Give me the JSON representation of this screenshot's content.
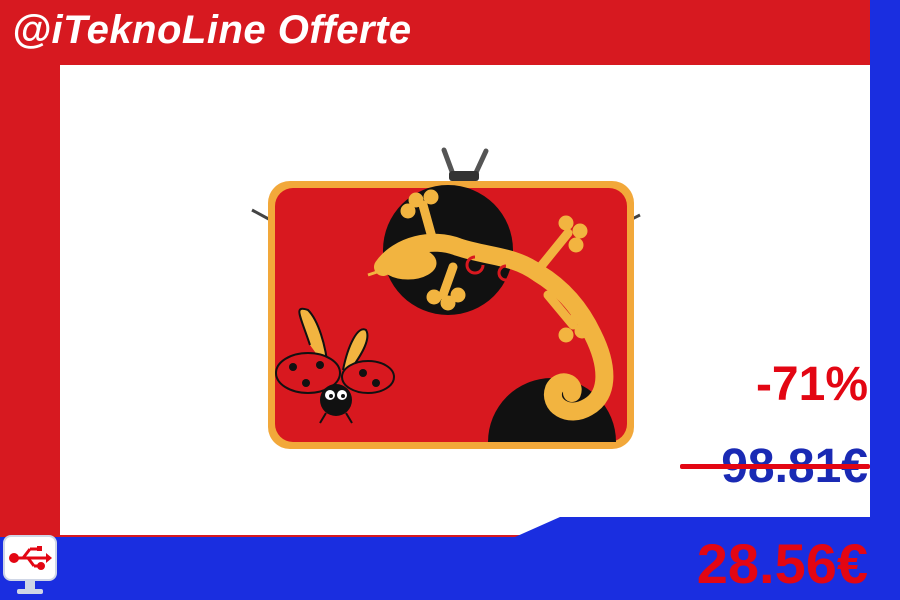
{
  "brand": {
    "title": "@iTeknoLine Offerte"
  },
  "product": {
    "image_name": "laptop-sleeve-red-gecko-ladybug",
    "colors": {
      "sleeve_red": "#d8181f",
      "sleeve_trim": "#f2a83a",
      "gecko_yellow": "#f2b440",
      "black": "#111111"
    }
  },
  "pricing": {
    "discount": "-71%",
    "old_price": "98.81€",
    "new_price": "28.56€"
  },
  "colors": {
    "brand_red": "#d71920",
    "brand_blue": "#1a2ee0",
    "price_red": "#e30613",
    "old_price_blue": "#1a2ab4",
    "white": "#ffffff"
  },
  "icons": {
    "logo": "usb-monitor-icon"
  }
}
